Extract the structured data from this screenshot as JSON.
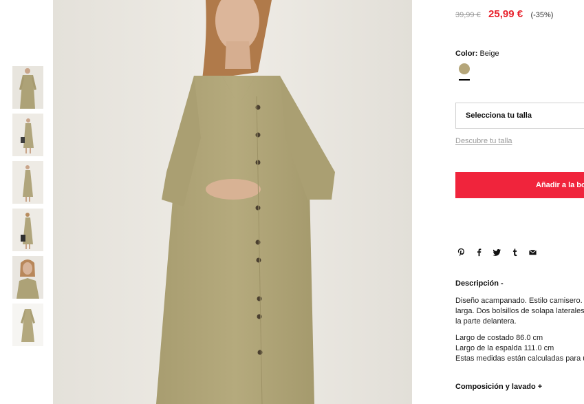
{
  "thumbnails": [
    {
      "label": "Vista frontal"
    },
    {
      "label": "Vista completa con bolso"
    },
    {
      "label": "Vista lateral"
    },
    {
      "label": "Vista espalda"
    },
    {
      "label": "Detalle superior"
    },
    {
      "label": "Prenda sola"
    }
  ],
  "price": {
    "old": "39,99 €",
    "current": "25,99 €",
    "discount": "(-35%)"
  },
  "color": {
    "label": "Color:",
    "value": "Beige",
    "swatch_hex": "#b5a67a"
  },
  "size": {
    "select_label": "Selecciona tu talla",
    "guide_link": "Descubre tu talla"
  },
  "cart": {
    "add_label": "Añadir a la bolsa",
    "button_color": "#f0243c"
  },
  "share": {
    "icons": [
      "pinterest-icon",
      "facebook-icon",
      "twitter-icon",
      "tumblr-icon",
      "mail-icon"
    ]
  },
  "description": {
    "title": "Descripción  -",
    "paragraph1": [
      "Diseño acampanado. Estilo camisero. Manga",
      "larga. Dos bolsillos de solapa laterales. Cierre",
      "la parte delantera."
    ],
    "paragraph2": [
      "Largo de costado 86.0 cm",
      "Largo de la espalda 111.0 cm",
      "Estas medidas están calculadas para una talla"
    ]
  },
  "composition": {
    "title": "Composición y lavado  +"
  }
}
